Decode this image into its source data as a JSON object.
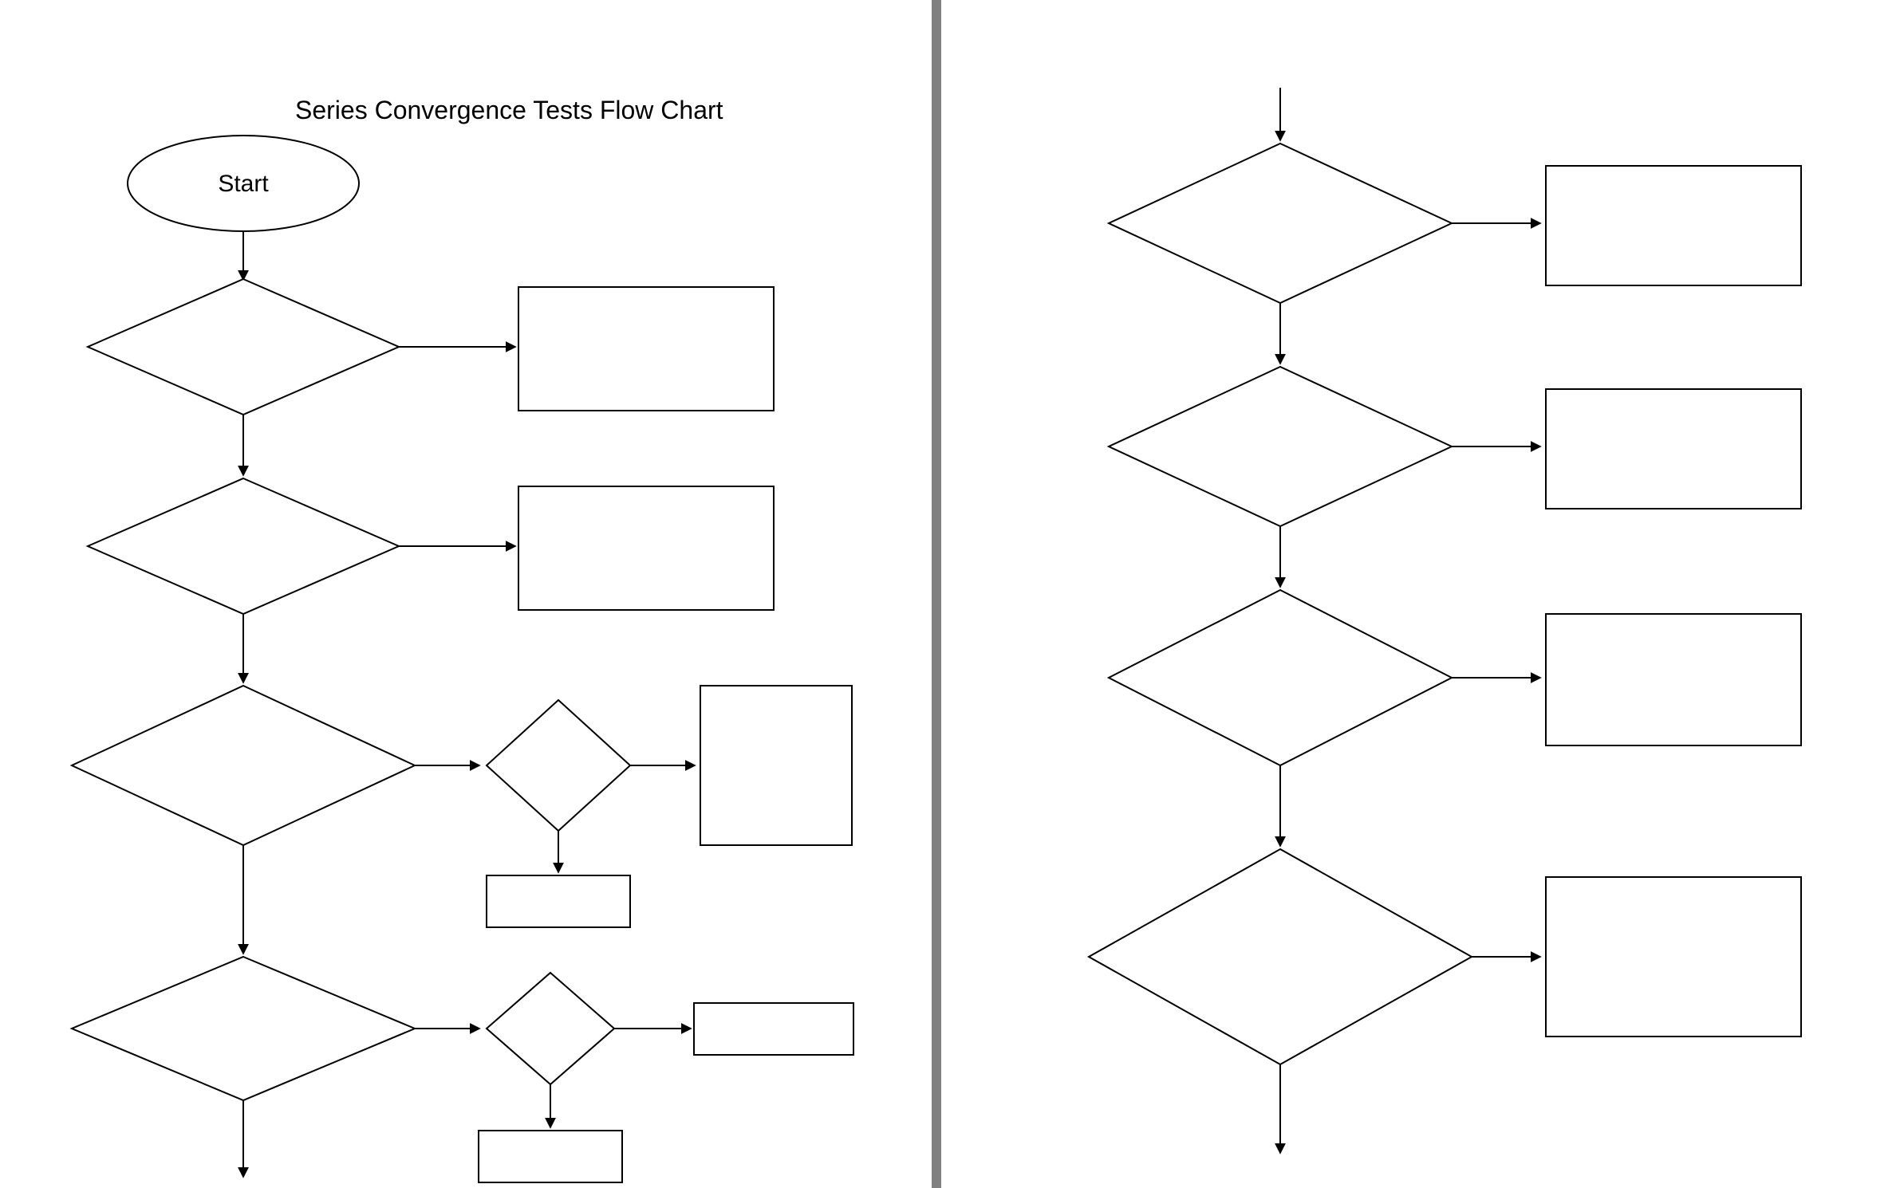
{
  "title": "Series Convergence Tests Flow Chart",
  "start_label": "Start",
  "left": {
    "diamond1": {
      "label": ""
    },
    "rect1": {
      "label": ""
    },
    "diamond2": {
      "label": ""
    },
    "rect2": {
      "label": ""
    },
    "diamond3": {
      "label": ""
    },
    "diamond3b": {
      "label": ""
    },
    "rect3": {
      "label": ""
    },
    "rect3b": {
      "label": ""
    },
    "diamond4": {
      "label": ""
    },
    "diamond4b": {
      "label": ""
    },
    "rect4": {
      "label": ""
    },
    "rect4b": {
      "label": ""
    }
  },
  "right": {
    "diamond1": {
      "label": ""
    },
    "rect1": {
      "label": ""
    },
    "diamond2": {
      "label": ""
    },
    "rect2": {
      "label": ""
    },
    "diamond3": {
      "label": ""
    },
    "rect3": {
      "label": ""
    },
    "diamond4": {
      "label": ""
    },
    "rect4": {
      "label": ""
    }
  },
  "colors": {
    "stroke": "#000000",
    "divider": "#808080",
    "bg": "#ffffff"
  }
}
